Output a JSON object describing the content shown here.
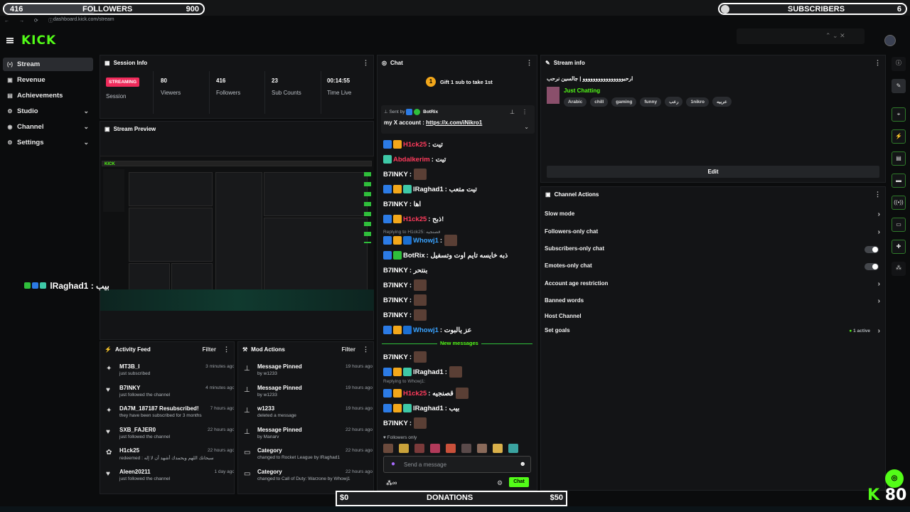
{
  "overlay": {
    "followers": {
      "current": "416",
      "label": "FOLLOWERS",
      "goal": "900",
      "progress": 0.46
    },
    "subscribers": {
      "label": "SUBSCRIBERS",
      "count": "6"
    },
    "donations": {
      "left": "$0",
      "label": "DONATIONS",
      "right": "$50"
    },
    "viewer_count": "80",
    "chat_overlay_name": "lRaghad1",
    "chat_overlay_msg": ": بيب"
  },
  "browser": {
    "url": "dashboard.kick.com/stream",
    "nav": "← → ⟳ ⓘ"
  },
  "header": {
    "logo": "KICK"
  },
  "sidebar": {
    "items": [
      {
        "label": "Stream",
        "icon": "(•)"
      },
      {
        "label": "Revenue",
        "icon": "▣"
      },
      {
        "label": "Achievements",
        "icon": "▤"
      },
      {
        "label": "Studio",
        "icon": "⚙"
      },
      {
        "label": "Channel",
        "icon": "◉"
      },
      {
        "label": "Settings",
        "icon": "⚙"
      }
    ]
  },
  "session": {
    "title": "Session Info",
    "status": "STREAMING",
    "session_label": "Session",
    "stats": [
      {
        "value": "80",
        "label": "Viewers"
      },
      {
        "value": "416",
        "label": "Followers"
      },
      {
        "value": "23",
        "label": "Sub Counts"
      },
      {
        "value": "00:14:55",
        "label": "Time Live"
      }
    ]
  },
  "preview": {
    "title": "Stream Preview"
  },
  "activity": {
    "title": "Activity Feed",
    "filter": "Filter",
    "items": [
      {
        "icon": "✦",
        "name": "MT3B_I",
        "sub": "just subscribed",
        "time": "3 minutes ago"
      },
      {
        "icon": "♥",
        "name": "B7INKY",
        "sub": "just followed the channel",
        "time": "4 minutes ago"
      },
      {
        "icon": "✦",
        "name": "DA7M_187187 Resubscribed!",
        "sub": "they have been subscribed for 3 months",
        "time": "7 hours ago"
      },
      {
        "icon": "♥",
        "name": "SXB_FAJER0",
        "sub": "just followed the channel",
        "time": "22 hours ago"
      },
      {
        "icon": "✿",
        "name": "H1ck25",
        "sub": "redeemed : سبحانك اللهم وبحمدك أشهد أن لا إله",
        "time": "22 hours ago"
      },
      {
        "icon": "♥",
        "name": "Aleen20211",
        "sub": "just followed the channel",
        "time": "1 day ago"
      }
    ]
  },
  "mod": {
    "title": "Mod Actions",
    "filter": "Filter",
    "items": [
      {
        "icon": "⊥",
        "name": "Message Pinned",
        "sub": "by w1233",
        "time": "19 hours ago"
      },
      {
        "icon": "⊥",
        "name": "Message Pinned",
        "sub": "by w1233",
        "time": "19 hours ago"
      },
      {
        "icon": "⊥",
        "name": "w1233",
        "sub": "deleted a message",
        "time": "19 hours ago"
      },
      {
        "icon": "⊥",
        "name": "Message Pinned",
        "sub": "by Manarv",
        "time": "22 hours ago"
      },
      {
        "icon": "▭",
        "name": "Category",
        "sub": "changed to Rocket League by lRaghad1",
        "time": "22 hours ago"
      },
      {
        "icon": "▭",
        "name": "Category",
        "sub": "changed to Call of Duty: Warzone by Whowj1",
        "time": "22 hours ago"
      }
    ]
  },
  "chat": {
    "title": "Chat",
    "gift": "Gift 1 sub to take 1st",
    "gift_count": "1",
    "pinned_by_label": "Sent by",
    "pinned_by": "BotRix",
    "pinned_text": "my X account :",
    "pinned_link": "https://x.com/iNikro1",
    "messages": [
      {
        "name": "H1ck25",
        "color": "#ff3b5c",
        "msg": ": تيت",
        "badges": [
          "#2c7be5",
          "#f2a71b"
        ],
        "emote": false
      },
      {
        "name": "Abdalkerim",
        "color": "#ff3b5c",
        "msg": ": تيت",
        "badges": [
          "#3ec9a7"
        ],
        "emote": false
      },
      {
        "name": "B7INKY",
        "color": "#ffffff",
        "msg": ":",
        "badges": [],
        "emote": true
      },
      {
        "name": "lRaghad1",
        "color": "#ffffff",
        "msg": ": تيت متعب",
        "badges": [
          "#2c7be5",
          "#f2a71b",
          "#3ec9a7"
        ],
        "emote": false
      },
      {
        "name": "B7INKY",
        "color": "#ffffff",
        "msg": ": اها",
        "badges": [],
        "emote": false
      },
      {
        "name": "H1ck25",
        "color": "#ff3b5c",
        "msg": ": ذبح!",
        "badges": [
          "#2c7be5",
          "#f2a71b"
        ],
        "emote": false
      },
      {
        "name": "Whowj1",
        "color": "#3aa3ff",
        "msg": ":",
        "badges": [
          "#2c7be5",
          "#f2a71b",
          "#1c6fd1"
        ],
        "emote": true
      },
      {
        "name": "BotRix",
        "color": "#ffffff",
        "msg": ": ذبه خايسه تايم اوت وتسفيل",
        "badges": [
          "#2c7be5",
          "#2fbf3b"
        ],
        "emote": false
      },
      {
        "name": "B7INKY",
        "color": "#ffffff",
        "msg": ": بنتحر",
        "badges": [],
        "emote": false
      },
      {
        "name": "B7INKY",
        "color": "#ffffff",
        "msg": ":",
        "badges": [],
        "emote": true
      },
      {
        "name": "B7INKY",
        "color": "#ffffff",
        "msg": ":",
        "badges": [],
        "emote": true
      },
      {
        "name": "B7INKY",
        "color": "#ffffff",
        "msg": ":",
        "badges": [],
        "emote": true
      },
      {
        "name": "Whowj1",
        "color": "#3aa3ff",
        "msg": ": عز يالبوت",
        "badges": [
          "#2c7be5",
          "#f2a71b",
          "#1c6fd1"
        ],
        "emote": false
      },
      {
        "name": "B7INKY",
        "color": "#ffffff",
        "msg": ":",
        "badges": [],
        "emote": true
      },
      {
        "name": "lRaghad1",
        "color": "#ffffff",
        "msg": ":",
        "badges": [
          "#2c7be5",
          "#f2a71b",
          "#3ec9a7"
        ],
        "emote": true
      },
      {
        "name": "H1ck25",
        "color": "#ff3b5c",
        "msg": ": قصنجيه",
        "badges": [
          "#2c7be5",
          "#f2a71b"
        ],
        "emote": true
      },
      {
        "name": "lRaghad1",
        "color": "#ffffff",
        "msg": ": بيب",
        "badges": [
          "#2c7be5",
          "#f2a71b",
          "#3ec9a7"
        ],
        "emote": false
      },
      {
        "name": "B7INKY",
        "color": "#ffffff",
        "msg": ":",
        "badges": [],
        "emote": true
      }
    ],
    "replies": [
      {
        "text": "Replying to H1ck25: قصنجيه"
      },
      {
        "text": "Replying to Whowj1:"
      }
    ],
    "new_messages": "New messages",
    "followers_only": "Followers only",
    "placeholder": "Send a message",
    "chat_button": "Chat"
  },
  "stream_info": {
    "title": "Stream info",
    "stream_title": "ارحبوووووووووووووووو | جالسين نرحب",
    "category": "Just Chatting",
    "tags": [
      "Arabic",
      "chill",
      "gaming",
      "funny",
      "رعب",
      "1nikro",
      "عربيه"
    ],
    "edit": "Edit"
  },
  "channel_actions": {
    "title": "Channel Actions",
    "items": [
      {
        "label": "Slow mode",
        "kind": "chevron"
      },
      {
        "label": "Followers-only chat",
        "kind": "chevron"
      },
      {
        "label": "Subscribers-only chat",
        "kind": "toggle"
      },
      {
        "label": "Emotes-only chat",
        "kind": "toggle"
      },
      {
        "label": "Account age restriction",
        "kind": "chevron"
      },
      {
        "label": "Banned words",
        "kind": "chevron"
      },
      {
        "label": "Host Channel",
        "kind": "none"
      },
      {
        "label": "Set goals",
        "kind": "chevron",
        "extra": "1 active"
      }
    ]
  },
  "colors": {
    "accent": "#53fc18",
    "live": "#ef2b5b"
  }
}
